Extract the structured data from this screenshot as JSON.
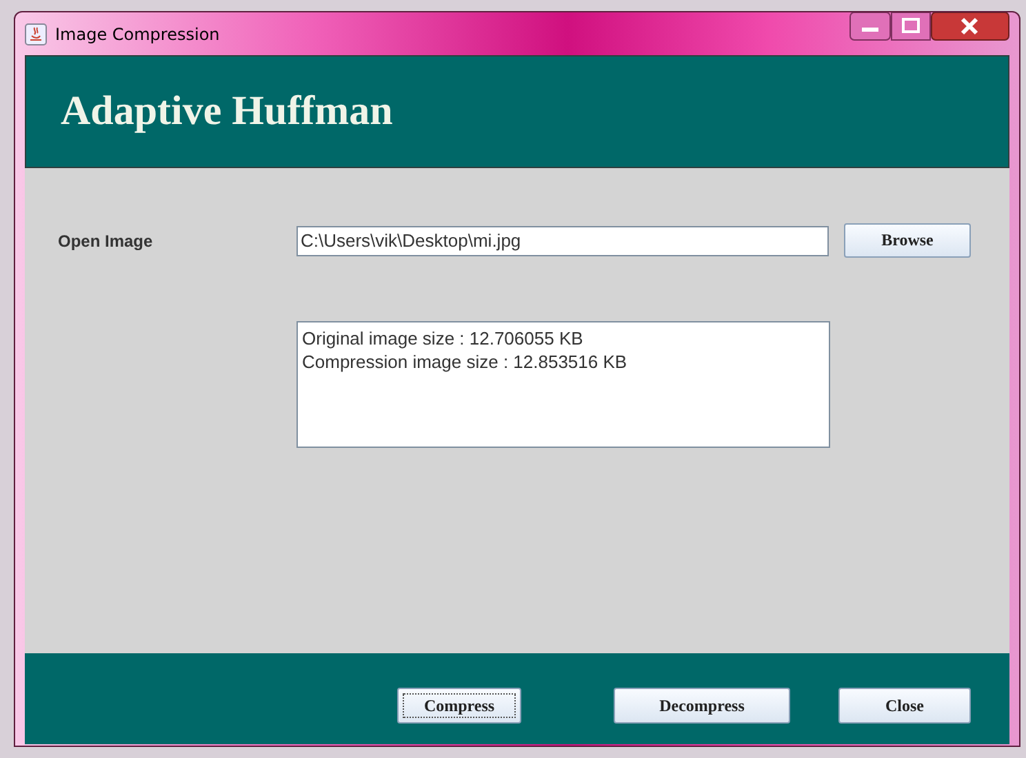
{
  "window": {
    "title": "Image Compression"
  },
  "header": {
    "title": "Adaptive Huffman"
  },
  "open_image": {
    "label": "Open Image",
    "value": "C:\\Users\\vik\\Desktop\\mi.jpg",
    "button": "Browse"
  },
  "output": {
    "lines": [
      "Original image size : 12.706055 KB",
      "Compression image size : 12.853516 KB"
    ]
  },
  "buttons": [
    {
      "label": "Compress",
      "focused": true
    },
    {
      "label": "Decompress",
      "focused": false
    },
    {
      "label": "Close",
      "focused": false
    }
  ]
}
